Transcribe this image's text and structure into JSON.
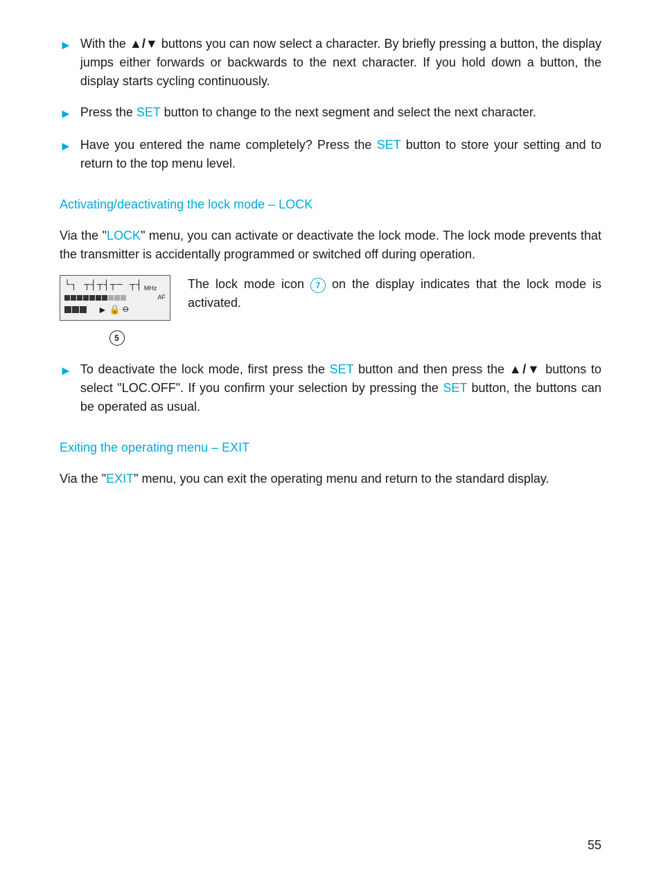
{
  "page": {
    "number": "55",
    "bullets": [
      {
        "id": "bullet1",
        "text_parts": [
          {
            "type": "text",
            "content": "With the "
          },
          {
            "type": "symbol",
            "content": "▲/▼"
          },
          {
            "type": "text",
            "content": " buttons you can now select a character. By briefly pressing a button, the display jumps either forwards or backwards to the next character. If you hold down a button, the display starts cycling continuously."
          }
        ]
      },
      {
        "id": "bullet2",
        "text_parts": [
          {
            "type": "text",
            "content": "Press the "
          },
          {
            "type": "cyan",
            "content": "SET"
          },
          {
            "type": "text",
            "content": " button to change to the next segment and select the next character."
          }
        ]
      },
      {
        "id": "bullet3",
        "text_parts": [
          {
            "type": "text",
            "content": "Have you entered the name completely? Press the "
          },
          {
            "type": "cyan",
            "content": "SET"
          },
          {
            "type": "text",
            "content": " button to store your setting and to return to the top menu level."
          }
        ]
      }
    ],
    "section_lock": {
      "title": "Activating/deactivating the lock mode – LOCK",
      "body1": "Via the \"LOCK\" menu, you can activate or deactivate the lock mode. The lock mode prevents that the transmitter is accidentally programmed or switched off during operation.",
      "lock_keyword": "LOCK",
      "annotation_text": "The lock mode icon ",
      "annotation_number": "7",
      "annotation_text2": " on the display indicates that the lock mode is activated.",
      "display_number": "5",
      "bullet4_parts": [
        {
          "type": "text",
          "content": "To deactivate the lock mode, first press the "
        },
        {
          "type": "cyan",
          "content": "SET"
        },
        {
          "type": "text",
          "content": " button and then press the "
        },
        {
          "type": "symbol",
          "content": "▲/▼"
        },
        {
          "type": "text",
          "content": " buttons to select \"LOC.OFF\". If you confirm your selection by pressing the "
        },
        {
          "type": "cyan",
          "content": "SET"
        },
        {
          "type": "text",
          "content": " button, the buttons can be operated as usual."
        }
      ]
    },
    "section_exit": {
      "title": "Exiting the operating menu – EXIT",
      "body_parts": [
        {
          "type": "text",
          "content": "Via the \""
        },
        {
          "type": "cyan",
          "content": "EXIT"
        },
        {
          "type": "text",
          "content": "\" menu, you can exit the operating menu and return to the standard display."
        }
      ]
    }
  }
}
